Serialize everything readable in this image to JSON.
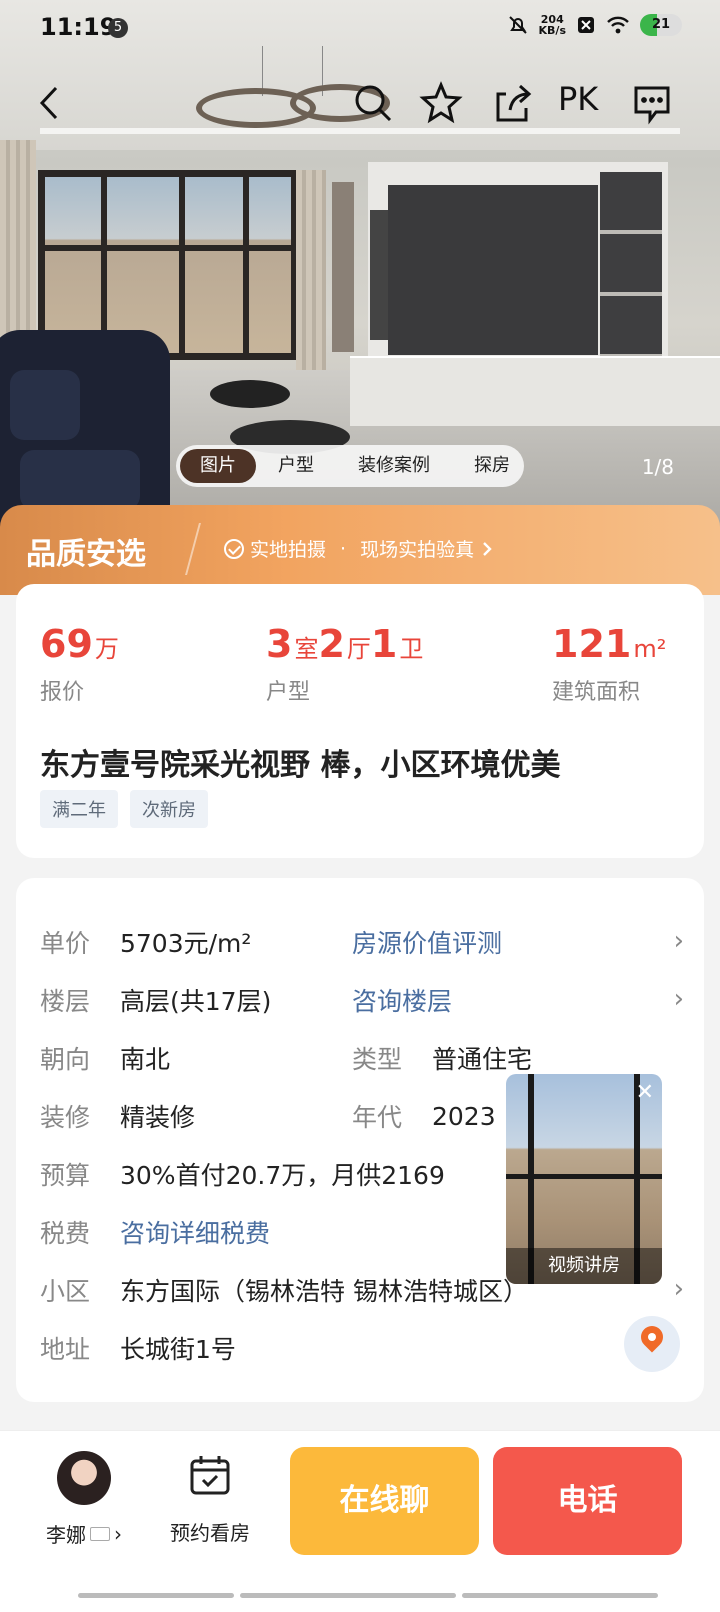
{
  "status_bar": {
    "time": "11:19",
    "notification_count": "5",
    "net_speed_value": "204",
    "net_speed_unit": "KB/s",
    "battery": "21"
  },
  "nav": {
    "icons": [
      "back-icon",
      "search-icon",
      "star-icon",
      "share-icon",
      "pk-button",
      "message-icon"
    ],
    "pk_label": "PK"
  },
  "gallery": {
    "tabs": [
      "图片",
      "户型",
      "装修案例",
      "探房"
    ],
    "active_tab": "图片",
    "pager": "1/8"
  },
  "quality": {
    "title": "品质安选",
    "subtitle_a": "实地拍摄",
    "subtitle_sep": "·",
    "subtitle_b": "现场实拍验真"
  },
  "price_card": {
    "price_value": "69",
    "price_unit": "万",
    "price_label": "报价",
    "layout_rooms": "3",
    "layout_rooms_unit": "室",
    "layout_halls": "2",
    "layout_halls_unit": "厅",
    "layout_baths": "1",
    "layout_baths_unit": "卫",
    "layout_label": "户型",
    "area_value": "121",
    "area_unit": "m²",
    "area_label": "建筑面积",
    "headline": "东方壹号院采光视野  棒，小区环境优美",
    "tags": [
      "满二年",
      "次新房"
    ]
  },
  "details": {
    "unit_price_key": "单价",
    "unit_price_val": "5703元/m²",
    "valuation_link": "房源价值评测",
    "floor_key": "楼层",
    "floor_val": "高层(共17层)",
    "floor_link": "咨询楼层",
    "orientation_key": "朝向",
    "orientation_val": "南北",
    "type_key": "类型",
    "type_val": "普通住宅",
    "decoration_key": "装修",
    "decoration_val": "精装修",
    "year_key": "年代",
    "year_val": "2023",
    "budget_key": "预算",
    "budget_val": "30%首付20.7万，月供2169",
    "tax_key": "税费",
    "tax_link": "咨询详细税费",
    "community_key": "小区",
    "community_val": "东方国际（锡林浩特 锡林浩特城区）",
    "address_key": "地址",
    "address_val": "长城街1号"
  },
  "video": {
    "label": "视频讲房",
    "close": "✕"
  },
  "bottom_bar": {
    "agent_name": "李娜",
    "appointment_label": "预约看房",
    "chat_label": "在线聊",
    "call_label": "电话"
  },
  "colors": {
    "accent_red": "#e8453a",
    "link_blue": "#4a6ea0",
    "chat_yellow": "#fcb93b",
    "call_red": "#f4584c",
    "quality_orange": "#f2a460"
  }
}
